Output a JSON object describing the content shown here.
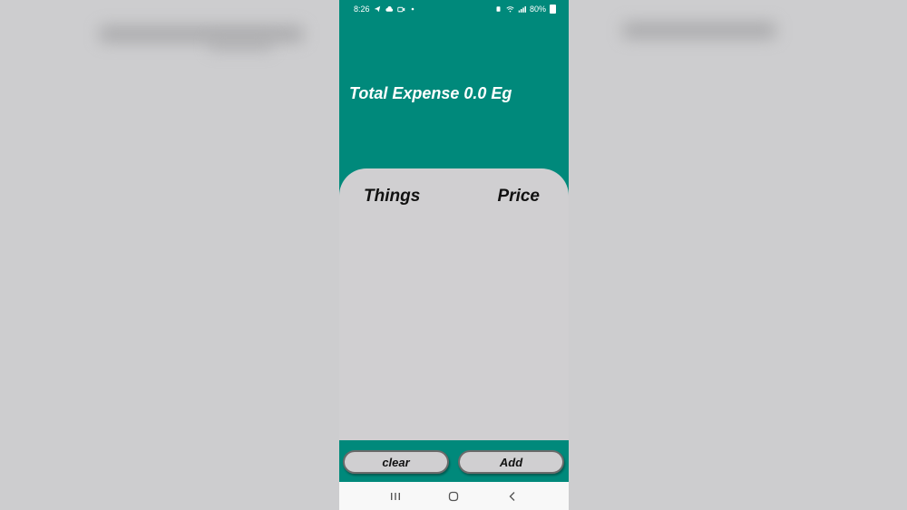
{
  "status_bar": {
    "time": "8:26",
    "battery": "80%"
  },
  "header": {
    "total_expense": "Total Expense 0.0 Eg"
  },
  "list": {
    "columns": [
      "Things",
      "Price"
    ],
    "items": []
  },
  "actions": {
    "clear_label": "clear",
    "add_label": "Add"
  },
  "nav": {
    "recents_icon": "recents-icon",
    "home_icon": "home-icon",
    "back_icon": "back-icon"
  },
  "colors": {
    "primary": "#00897b",
    "card": "#d0cfd1",
    "nav_bar": "#f8f8f8"
  }
}
